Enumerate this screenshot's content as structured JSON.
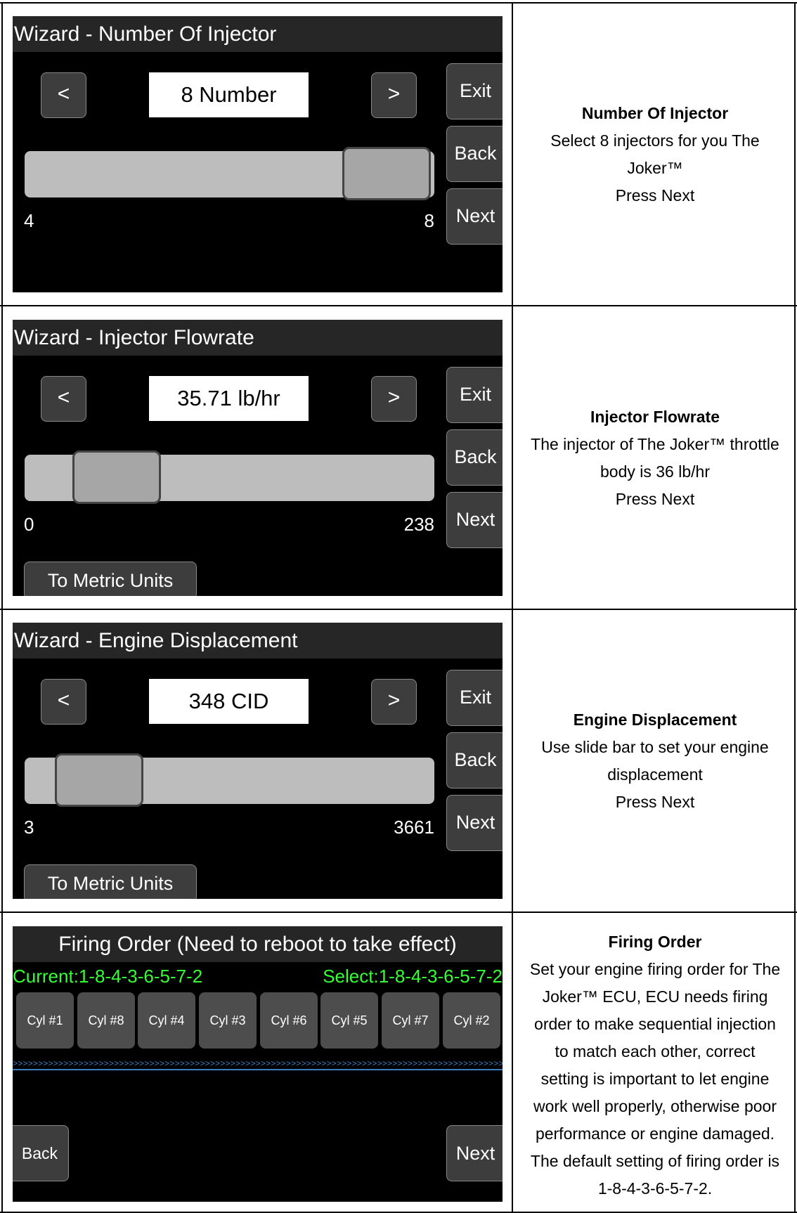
{
  "panels": [
    {
      "title": "Wizard - Number Of Injector",
      "dec_label": "<",
      "inc_label": ">",
      "value": "8 Number",
      "slider_min": "4",
      "slider_max": "8",
      "slider_level": 1.0,
      "exit_label": "Exit",
      "back_label": "Back",
      "next_label": "Next",
      "desc_heading": "Number Of Injector",
      "desc_lines": [
        "Select 8 injectors for you The",
        "Joker™",
        "Press Next"
      ]
    },
    {
      "title": "Wizard - Injector Flowrate",
      "dec_label": "<",
      "inc_label": ">",
      "value": "35.71 lb/hr",
      "slider_min": "0",
      "slider_max": "238",
      "slider_level": 0.15,
      "exit_label": "Exit",
      "back_label": "Back",
      "next_label": "Next",
      "metric_label": "To Metric Units",
      "desc_heading": "Injector Flowrate",
      "desc_lines": [
        "The injector of The Joker™ throttle",
        "body is 36 lb/hr",
        "Press Next"
      ]
    },
    {
      "title": "Wizard - Engine Displacement",
      "dec_label": "<",
      "inc_label": ">",
      "value": "348 CID",
      "slider_min": "3",
      "slider_max": "3661",
      "slider_level": 0.095,
      "exit_label": "Exit",
      "back_label": "Back",
      "next_label": "Next",
      "metric_label": "To Metric Units",
      "desc_heading": "Engine Displacement",
      "desc_lines": [
        "Use slide bar to set your engine",
        "displacement",
        "Press Next"
      ]
    }
  ],
  "firing": {
    "title": "Firing Order (Need to reboot to take effect)",
    "current": "Current:1-8-4-3-6-5-7-2",
    "select": "Select:1-8-4-3-6-5-7-2",
    "cylinders": [
      "Cyl #1",
      "Cyl #8",
      "Cyl #4",
      "Cyl #3",
      "Cyl #6",
      "Cyl #5",
      "Cyl #7",
      "Cyl #2"
    ],
    "back_label": "Back",
    "next_label": "Next",
    "desc_heading": "Firing Order",
    "desc_lines": [
      "Set your engine firing order for The",
      "Joker™ ECU, ECU needs firing",
      "order to make sequential injection",
      "to match each other, correct",
      "setting is important to let engine",
      "work well properly, otherwise poor",
      "performance or engine damaged.",
      "The default setting of firing order is",
      "1-8-4-3-6-5-7-2."
    ]
  },
  "colors": {
    "screen_bg": "#000000",
    "titlebar": "#262626",
    "button": "#3d3d3d",
    "track": "#bdbdbd",
    "thumb": "#a6a6a6",
    "status_green": "#33ff33",
    "divider_blue": "#3a7fc0"
  }
}
